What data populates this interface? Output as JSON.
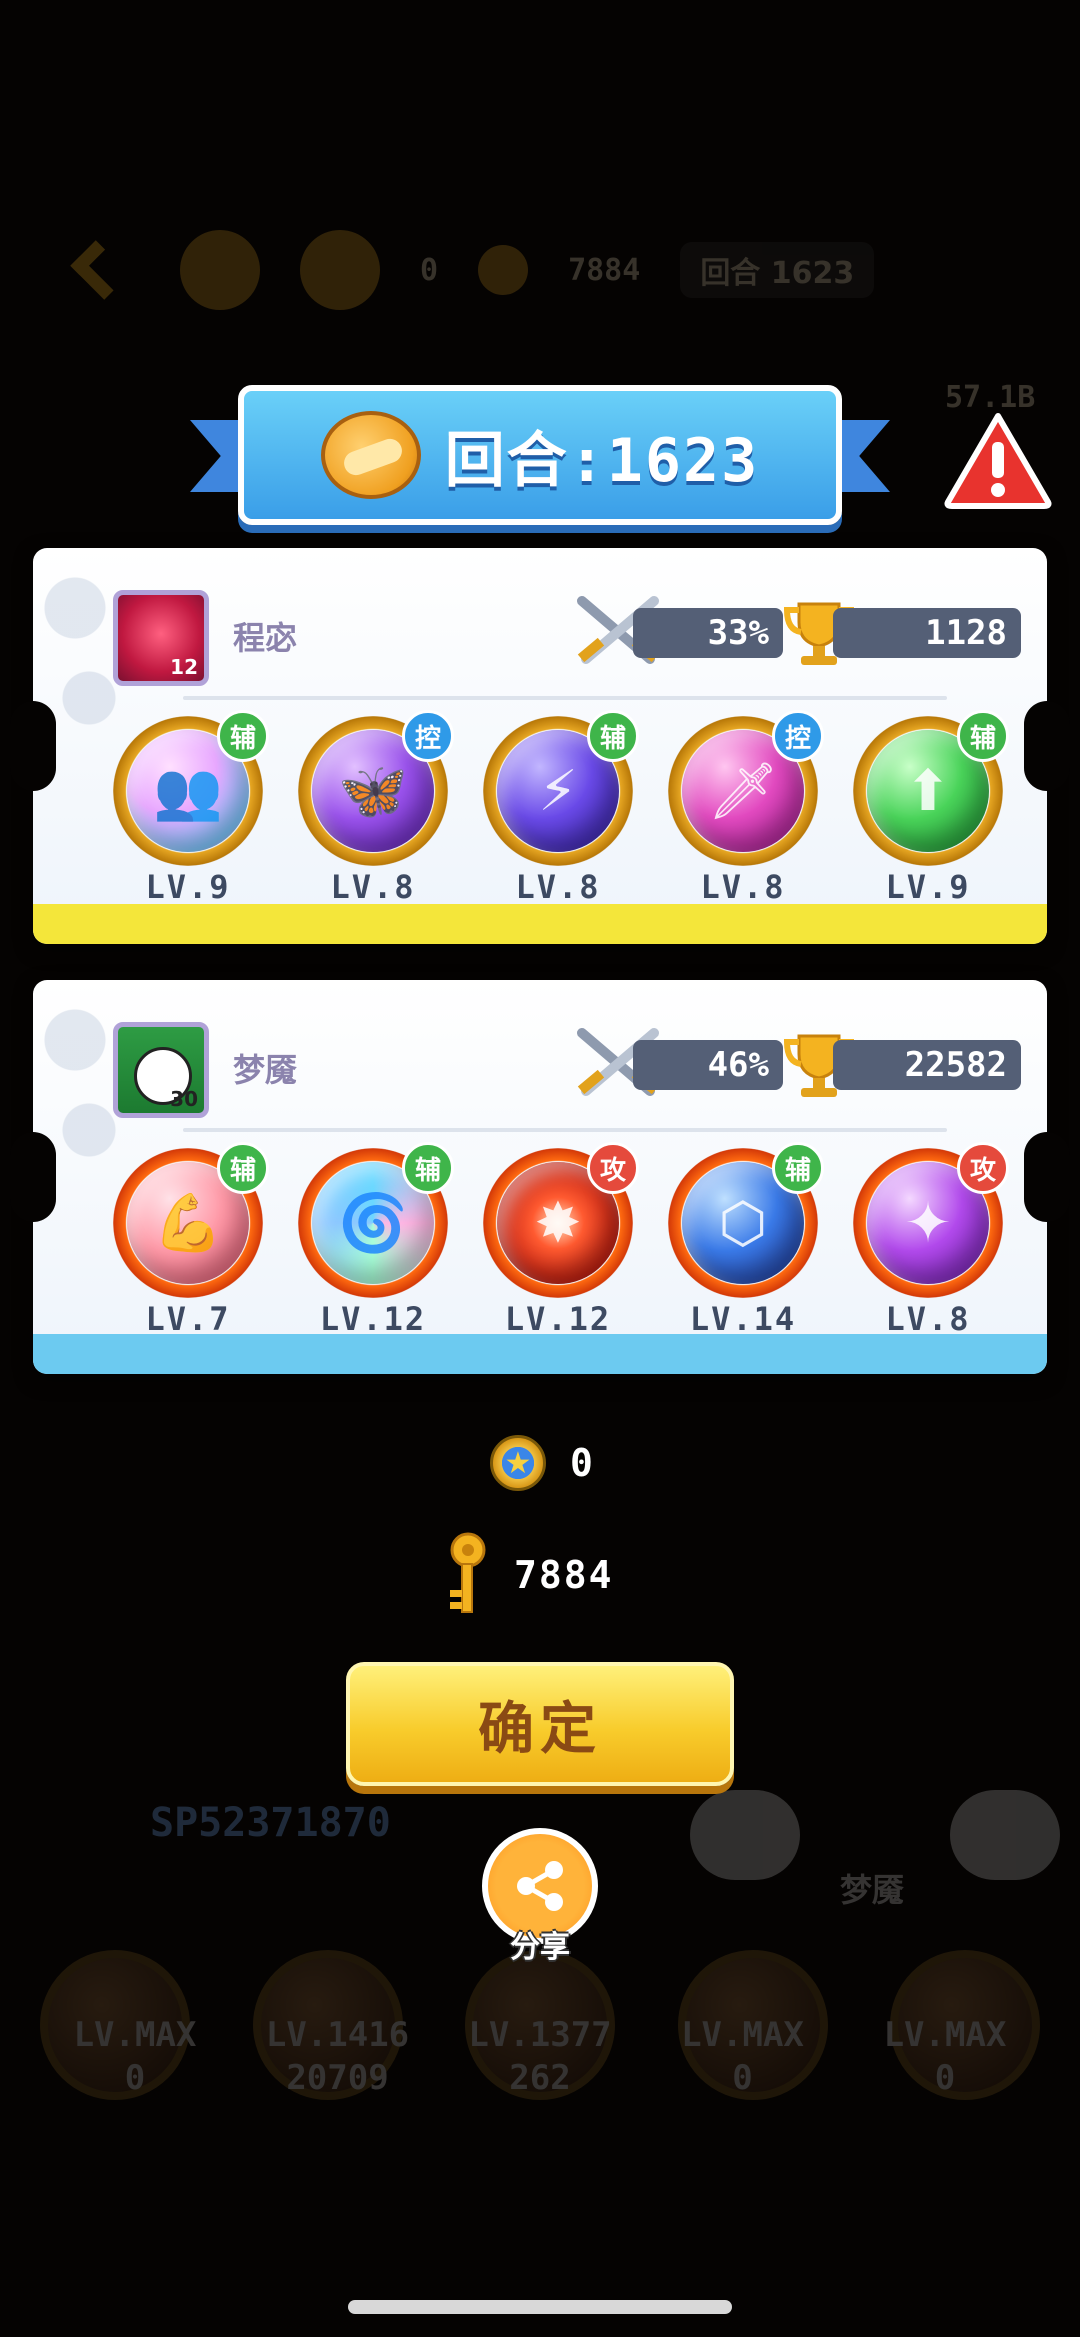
{
  "background": {
    "stars_value": "0",
    "keys_value": "7884",
    "round_pill": "回合 1623",
    "side_value": "57.1B",
    "sp_value": "SP52371870",
    "name": "梦魇",
    "levels": [
      "LV.MAX",
      "LV.1416",
      "LV.1377",
      "LV.MAX",
      "LV.MAX"
    ],
    "counts": [
      "0",
      "20709",
      "262",
      "0",
      "0"
    ]
  },
  "banner": {
    "title": "回合:1623"
  },
  "players": [
    {
      "name": "程宓",
      "avatar_level": "12",
      "win_rate": "33%",
      "trophies": "1128",
      "skills": [
        {
          "role": "辅",
          "level": "LV.9",
          "glyph": "👥"
        },
        {
          "role": "控",
          "level": "LV.8",
          "glyph": "🦋"
        },
        {
          "role": "辅",
          "level": "LV.8",
          "glyph": "⚡"
        },
        {
          "role": "控",
          "level": "LV.8",
          "glyph": "🗡"
        },
        {
          "role": "辅",
          "level": "LV.9",
          "glyph": "⬆"
        }
      ]
    },
    {
      "name": "梦魇",
      "avatar_level": "30",
      "win_rate": "46%",
      "trophies": "22582",
      "skills": [
        {
          "role": "辅",
          "level": "LV.7",
          "glyph": "💪"
        },
        {
          "role": "辅",
          "level": "LV.12",
          "glyph": "🌀"
        },
        {
          "role": "攻",
          "level": "LV.12",
          "glyph": "✸"
        },
        {
          "role": "辅",
          "level": "LV.14",
          "glyph": "⬡"
        },
        {
          "role": "攻",
          "level": "LV.8",
          "glyph": "✦"
        }
      ]
    }
  ],
  "resources": {
    "stars": "0",
    "keys": "7884"
  },
  "buttons": {
    "confirm": "确定",
    "share": "分享"
  },
  "colors": {
    "role_support": "#3fb54a",
    "role_control": "#2f9ae8",
    "role_attack": "#e54a3c",
    "confirm": "#f8cc2c",
    "banner": "#3a9ee8"
  }
}
